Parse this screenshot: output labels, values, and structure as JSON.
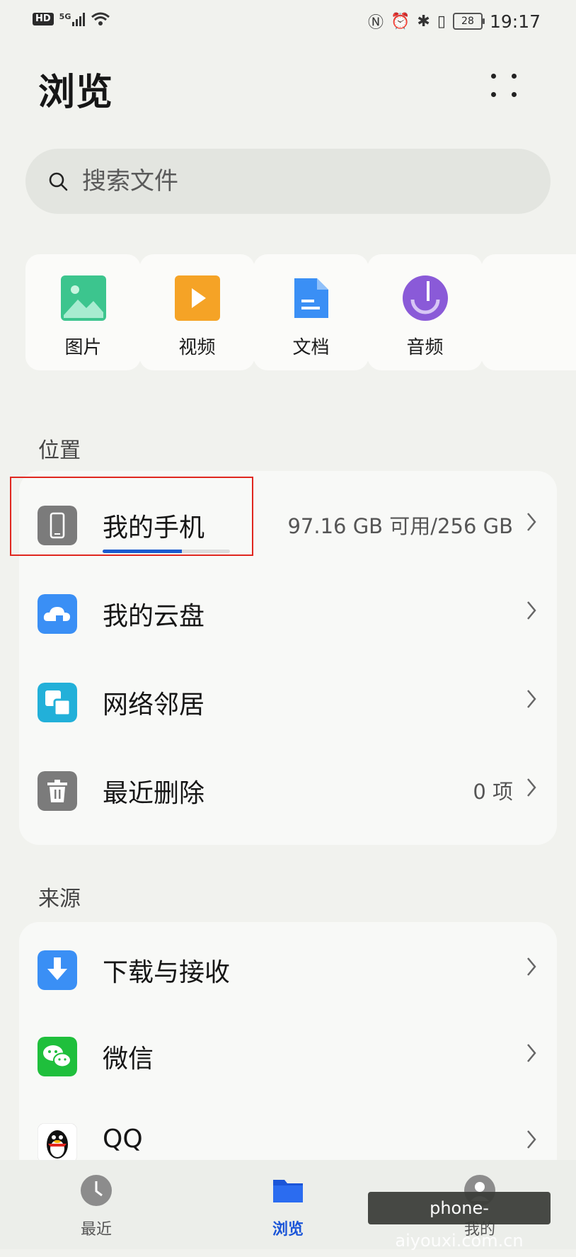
{
  "status_bar": {
    "hd": "HD",
    "network": "5G",
    "battery": "28",
    "time": "19:17"
  },
  "header": {
    "title": "浏览"
  },
  "search": {
    "placeholder": "搜索文件"
  },
  "categories": [
    {
      "label": "图片",
      "icon": "image-icon",
      "color": "#3cc58e"
    },
    {
      "label": "视频",
      "icon": "video-icon",
      "color": "#f5a326"
    },
    {
      "label": "文档",
      "icon": "document-icon",
      "color": "#3a8ff5"
    },
    {
      "label": "音频",
      "icon": "audio-icon",
      "color": "#8a5ad8"
    }
  ],
  "locations": {
    "title": "位置",
    "items": [
      {
        "label": "我的手机",
        "value": "97.16 GB 可用/256 GB",
        "icon": "phone-icon",
        "usage_fraction": 0.62
      },
      {
        "label": "我的云盘",
        "value": "",
        "icon": "cloud-icon"
      },
      {
        "label": "网络邻居",
        "value": "",
        "icon": "network-icon"
      },
      {
        "label": "最近删除",
        "value": "0 项",
        "icon": "trash-icon"
      }
    ]
  },
  "sources": {
    "title": "来源",
    "items": [
      {
        "label": "下载与接收",
        "icon": "download-icon"
      },
      {
        "label": "微信",
        "icon": "wechat-icon"
      },
      {
        "label": "QQ",
        "icon": "qq-icon"
      }
    ]
  },
  "bottom_nav": [
    {
      "label": "最近",
      "icon": "clock-icon",
      "active": false
    },
    {
      "label": "浏览",
      "icon": "folder-icon",
      "active": true
    },
    {
      "label": "我的",
      "icon": "person-icon",
      "active": false
    }
  ],
  "watermark": "phone-aiyouxi.com.cn",
  "colors": {
    "accent": "#1b55d8",
    "highlight": "#e0271f"
  }
}
